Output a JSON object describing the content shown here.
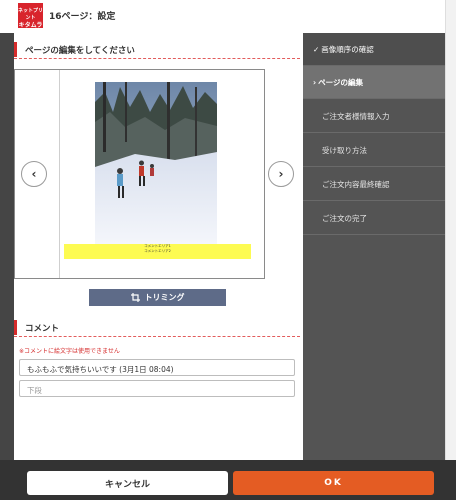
{
  "header": {
    "logo_top": "ネットプリント",
    "logo_main": "キタムラ",
    "title": "16ページ：設定"
  },
  "edit_section": {
    "heading": "ページの編集をしてください",
    "prev_icon": "chevron-left",
    "next_icon": "chevron-right",
    "comment_area_1": "コメントエリア1",
    "comment_area_2": "コメントエリア2",
    "trim_label": "トリミング",
    "trim_icon": "crop-icon"
  },
  "comment_section": {
    "heading": "コメント",
    "notice": "※コメントに絵文字は使用できません",
    "upper_value": "もふもふで気持ちいいです (3月1日 08:04)",
    "lower_placeholder": "下段"
  },
  "steps": [
    {
      "label": "画像順序の確認",
      "state": "done",
      "icon": "check"
    },
    {
      "label": "ページの編集",
      "state": "current",
      "icon": "chevron-right"
    },
    {
      "label": "ご注文者様情報入力",
      "state": "todo"
    },
    {
      "label": "受け取り方法",
      "state": "todo"
    },
    {
      "label": "ご注文内容最終確認",
      "state": "todo"
    },
    {
      "label": "ご注文の完了",
      "state": "todo"
    }
  ],
  "footer": {
    "cancel_label": "キャンセル",
    "ok_label": "OK"
  },
  "colors": {
    "brand_red": "#d8242c",
    "ok_orange": "#e45c23",
    "trim_blue": "#5e6b88",
    "caption_yellow": "#fdfb52"
  }
}
